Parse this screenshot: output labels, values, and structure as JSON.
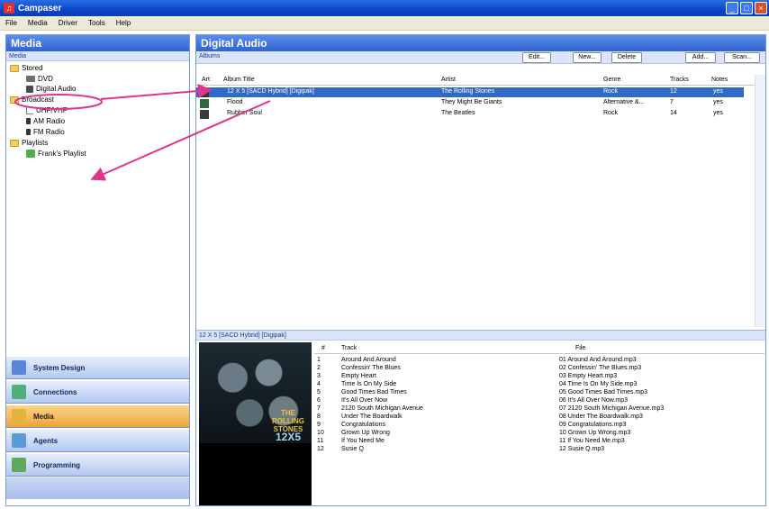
{
  "app": {
    "title": "Campaser"
  },
  "menu": [
    "File",
    "Media",
    "Driver",
    "Tools",
    "Help"
  ],
  "left": {
    "header": "Media",
    "subheader": "Media",
    "tree": {
      "stored": "Stored",
      "dvd": "DVD",
      "digital_audio": "Digital Audio",
      "broadcast": "Broadcast",
      "uhf": "UHF/VHF",
      "am": "AM Radio",
      "fm": "FM Radio",
      "playlists": "Playlists",
      "franks": "Frank's Playlist"
    },
    "nav": [
      "System Design",
      "Connections",
      "Media",
      "Agents",
      "Programming"
    ]
  },
  "right": {
    "header": "Digital Audio",
    "toolbar_label": "Albums",
    "buttons": {
      "edit": "Edit...",
      "new": "New...",
      "delete": "Delete",
      "add": "Add...",
      "scan": "Scan..."
    },
    "columns": {
      "art": "Art",
      "title": "Album Title",
      "artist": "Artist",
      "genre": "Genre",
      "tracks": "Tracks",
      "notes": "Notes"
    },
    "albums": [
      {
        "title": "12 X 5 [SACD Hybrid] [Digipak]",
        "artist": "The Rolling Stones",
        "genre": "Rock",
        "tracks": "12",
        "notes": "yes"
      },
      {
        "title": "Flood",
        "artist": "They Might Be Giants",
        "genre": "Alternative &...",
        "tracks": "7",
        "notes": "yes"
      },
      {
        "title": "Rubber Soul",
        "artist": "The Beatles",
        "genre": "Rock",
        "tracks": "14",
        "notes": "yes"
      }
    ],
    "details_title": "12 X 5 [SACD Hybrid] [Digipak]",
    "cover": {
      "line1": "THE",
      "line2": "ROLLING",
      "line3": "STONES",
      "line4": "12X5"
    },
    "track_columns": {
      "num": "#",
      "track": "Track",
      "file": "File"
    },
    "tracks": [
      {
        "n": "1",
        "t": "Around And Around",
        "f": "01 Around And Around.mp3"
      },
      {
        "n": "2",
        "t": "Confessin' The Blues",
        "f": "02 Confessin' The Blues.mp3"
      },
      {
        "n": "3",
        "t": "Empty Heart",
        "f": "03 Empty Heart.mp3"
      },
      {
        "n": "4",
        "t": "Time Is On My Side",
        "f": "04 Time Is On My Side.mp3"
      },
      {
        "n": "5",
        "t": "Good Times Bad Times",
        "f": "05 Good Times Bad Times.mp3"
      },
      {
        "n": "6",
        "t": "It's All Over Now",
        "f": "06 It's All Over Now.mp3"
      },
      {
        "n": "7",
        "t": "2120 South Michigan Avenue",
        "f": "07 2120 South Michigan Avenue.mp3"
      },
      {
        "n": "8",
        "t": "Under The Boardwalk",
        "f": "08 Under The Boardwalk.mp3"
      },
      {
        "n": "9",
        "t": "Congratulations",
        "f": "09 Congratulations.mp3"
      },
      {
        "n": "10",
        "t": "Grown Up Wrong",
        "f": "10 Grown Up Wrong.mp3"
      },
      {
        "n": "11",
        "t": "If You Need Me",
        "f": "11 If You Need Me.mp3"
      },
      {
        "n": "12",
        "t": "Susie Q",
        "f": "12 Susie Q.mp3"
      }
    ]
  },
  "colors": {
    "header": "#2f62d0",
    "selection": "#316ac5",
    "annotation": "#e0358a",
    "active_nav": "#eea43a"
  }
}
